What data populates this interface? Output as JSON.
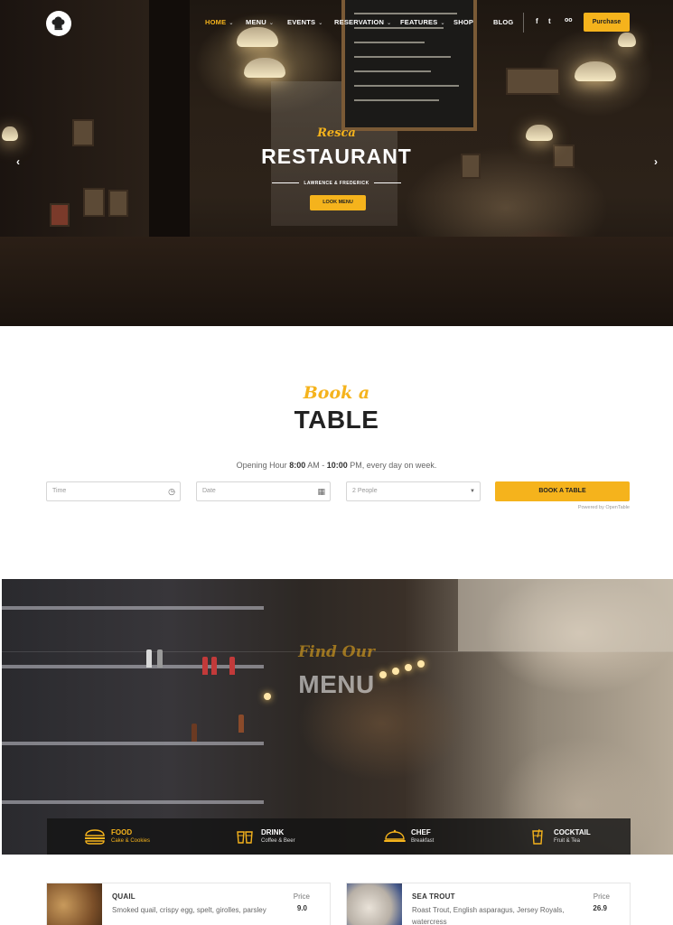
{
  "nav": {
    "items": [
      {
        "label": "HOME",
        "caret": "⌄"
      },
      {
        "label": "MENU",
        "caret": "⌄"
      },
      {
        "label": "EVENTS",
        "caret": "⌄"
      },
      {
        "label": "RESERVATION",
        "caret": "⌄"
      },
      {
        "label": "FEATURES",
        "caret": "⌄"
      },
      {
        "label": "SHOP",
        "caret": ""
      },
      {
        "label": "BLOG",
        "caret": ""
      }
    ],
    "social": [
      "f",
      "t",
      "oo"
    ],
    "purchase_label": "Purchase"
  },
  "hero": {
    "script": "Resca",
    "title": "RESTAURANT",
    "subtitle": "LAWRENCE & FREDERICK",
    "button_label": "LOOK MENU",
    "arrow_prev": "‹",
    "arrow_next": "›"
  },
  "booking": {
    "script": "Book a",
    "title": "TABLE",
    "opening_prefix": "Opening Hour",
    "open_time": "8:00",
    "open_ampm": "AM -",
    "close_time": "10:00",
    "opening_suffix": "PM, every day on week.",
    "time_placeholder": "Time",
    "date_placeholder": "Date",
    "people_value": "2 People",
    "button_label": "BOOK A TABLE",
    "powered": "Powered by OpenTable"
  },
  "menu_section": {
    "script": "Find Our",
    "title": "MENU",
    "tabs": [
      {
        "name": "FOOD",
        "desc": "Cake & Cookies",
        "icon": "burger-icon"
      },
      {
        "name": "DRINK",
        "desc": "Coffee & Beer",
        "icon": "drink-icon"
      },
      {
        "name": "CHEF",
        "desc": "Breakfast",
        "icon": "dish-icon"
      },
      {
        "name": "COCKTAIL",
        "desc": "Fruit & Tea",
        "icon": "cocktail-icon"
      }
    ]
  },
  "menu_items": [
    {
      "name": "QUAIL",
      "desc": "Smoked quail, crispy egg, spelt, girolles, parsley",
      "price_label": "Price",
      "price": "9.0"
    },
    {
      "name": "SEA TROUT",
      "desc": "Roast Trout, English asparagus, Jersey Royals, watercress",
      "price_label": "Price",
      "price": "26.9"
    }
  ],
  "colors": {
    "accent": "#f5b31c",
    "dark": "#222222"
  }
}
